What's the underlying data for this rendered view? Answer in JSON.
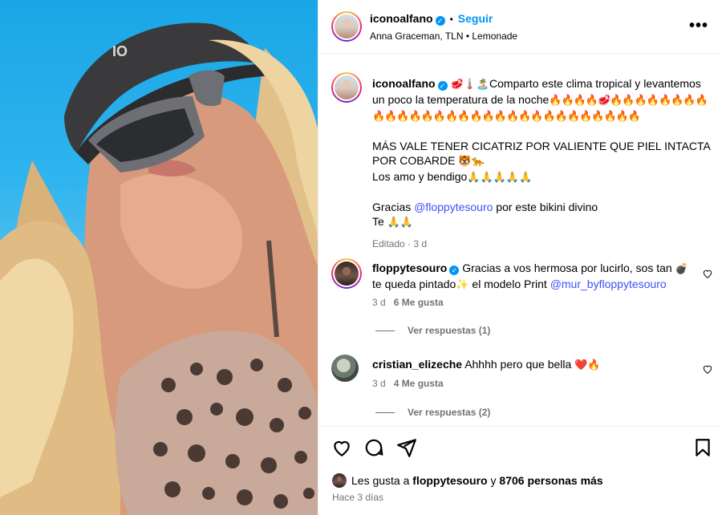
{
  "post": {
    "username": "iconoalfano",
    "follow_label": "Seguir",
    "location_line": "Anna Graceman, TLN • Lemonade",
    "more_label": "•••"
  },
  "caption": {
    "username": "iconoalfano",
    "line1_emoji": "🥩🌡️🏝️",
    "line1_text": "Comparto este clima tropical y levantemos un poco la temperatura de la noche",
    "line2_emoji": "🔥🔥🔥🔥🥩🔥🔥🔥🔥🔥🔥🔥🔥🔥🔥🔥🔥🔥🔥🔥🔥🔥🔥🔥🔥🔥🔥🔥🔥🔥🔥🔥🔥🔥🔥",
    "para2": "MÁS VALE TENER CICATRIZ POR VALIENTE QUE PIEL INTACTA POR COBARDE",
    "para2_emoji": "🐯🐆",
    "line_love": "Los amo y bendigo",
    "line_love_glyphs": "🙏🙏🙏🙏🙏",
    "thanks_pre": "Gracias ",
    "thanks_mention": "@floppytesouro",
    "thanks_post": " por este bikini divino",
    "te_line": "Te ",
    "te_glyphs": "🙏🙏",
    "meta": "Editado · 3 d"
  },
  "comments": [
    {
      "username": "floppytesouro",
      "text_a": "Gracias a vos hermosa por lucirlo, sos tan ",
      "emoji_a": "💣",
      "text_b": "te queda pintado",
      "emoji_b": "✨",
      "text_c": " el modelo Print ",
      "mention": "@mur_byfloppytesouro",
      "age": "3 d",
      "likes": "6 Me gusta",
      "replies": "Ver respuestas (1)"
    },
    {
      "username": "cristian_elizeche",
      "text": "Ahhhh pero que bella ",
      "emoji": "❤️🔥",
      "age": "3 d",
      "likes": "4 Me gusta",
      "replies": "Ver respuestas (2)"
    }
  ],
  "footer": {
    "likes_prefix": "Les gusta a ",
    "likes_user": "floppytesouro",
    "likes_mid": " y ",
    "likes_count": "8706 personas más",
    "time_ago": "Hace 3 días"
  },
  "icons": [
    "heart-icon",
    "comment-icon",
    "share-icon",
    "bookmark-icon",
    "verified-icon",
    "more-options-icon"
  ],
  "colors": {
    "accent": "#0095f6",
    "mention": "#4150f7",
    "muted": "#737373"
  }
}
